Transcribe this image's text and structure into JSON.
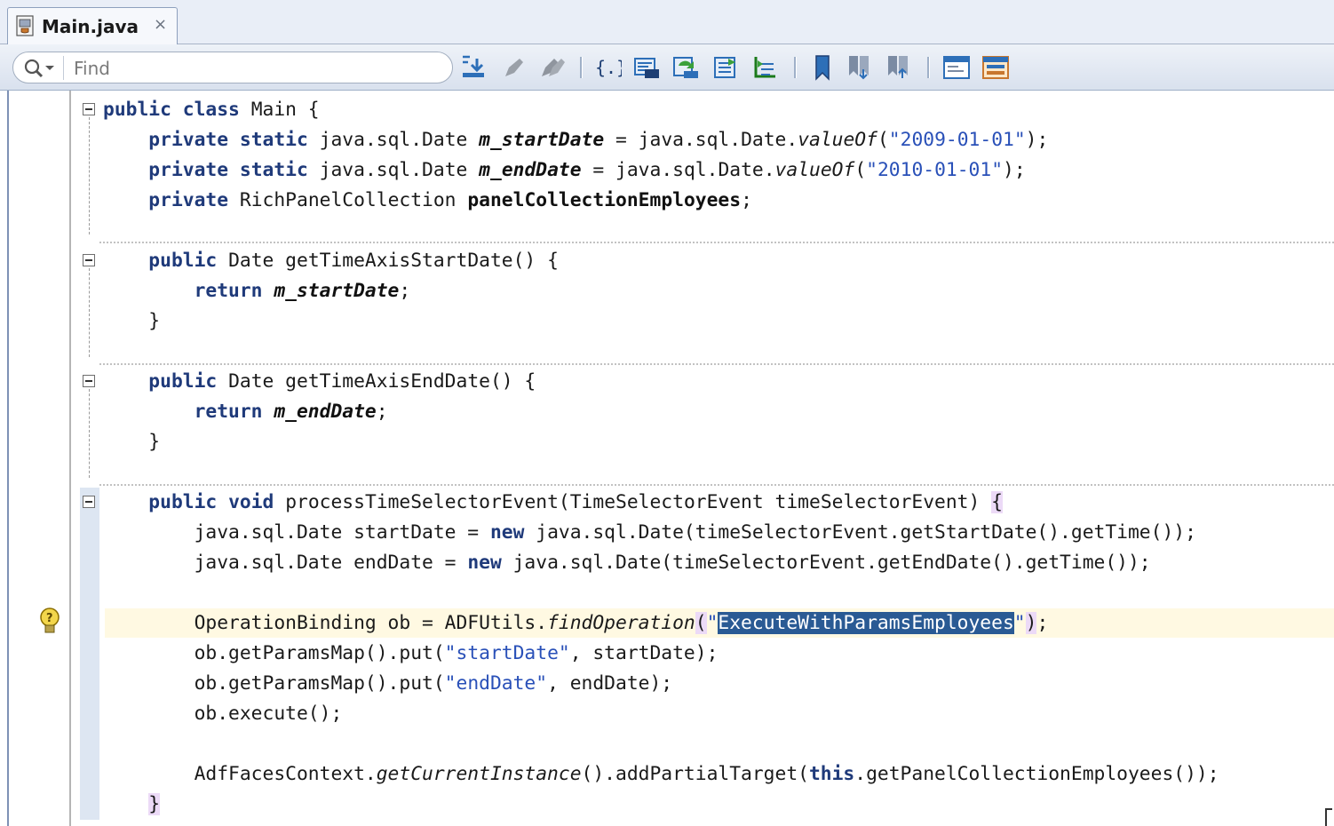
{
  "tab": {
    "label": "Main.java",
    "close": "×"
  },
  "toolbar": {
    "search_placeholder": "Find"
  },
  "code": {
    "l1": [
      "public",
      "class",
      "Main {"
    ],
    "l2": [
      "private",
      "static",
      "java.sql.Date",
      "m_startDate",
      " = java.sql.Date.",
      "valueOf",
      "(",
      "\"2009-01-01\"",
      ");"
    ],
    "l3": [
      "private",
      "static",
      "java.sql.Date",
      "m_endDate",
      " = java.sql.Date.",
      "valueOf",
      "(",
      "\"2010-01-01\"",
      ");"
    ],
    "l4": [
      "private",
      "RichPanelCollection",
      "panelCollectionEmployees",
      ";"
    ],
    "l5": [
      "public",
      "Date getTimeAxisStartDate() {"
    ],
    "l6": [
      "return",
      "m_startDate",
      ";"
    ],
    "l7": "}",
    "l8": [
      "public",
      "Date getTimeAxisEndDate() {"
    ],
    "l9": [
      "return",
      "m_endDate",
      ";"
    ],
    "l10": "}",
    "l11": [
      "public",
      "void",
      "processTimeSelectorEvent(TimeSelectorEvent timeSelectorEvent) ",
      "{"
    ],
    "l12": [
      "java.sql.Date startDate = ",
      "new",
      " java.sql.Date(timeSelectorEvent.getStartDate().getTime());"
    ],
    "l13": [
      "java.sql.Date endDate = ",
      "new",
      " java.sql.Date(timeSelectorEvent.getEndDate().getTime());"
    ],
    "l14": [
      "OperationBinding ob = ADFUtils.",
      "findOperation",
      "(",
      "\"",
      "ExecuteWithParamsEmployees",
      "\"",
      ")",
      ";"
    ],
    "l15": [
      "ob.getParamsMap().put(",
      "\"startDate\"",
      ", startDate);"
    ],
    "l16": [
      "ob.getParamsMap().put(",
      "\"endDate\"",
      ", endDate);"
    ],
    "l17": "ob.execute();",
    "l18": [
      "AdfFacesContext.",
      "getCurrentInstance",
      "().addPartialTarget(",
      "this",
      ".getPanelCollectionEmployees());"
    ],
    "l19": "}"
  },
  "colors": {
    "keyword": "#1f3a7a",
    "string": "#2950b8",
    "selection": "#2a5a94",
    "current_line": "#fff9e2",
    "brace_match": "#ecdaf7"
  }
}
